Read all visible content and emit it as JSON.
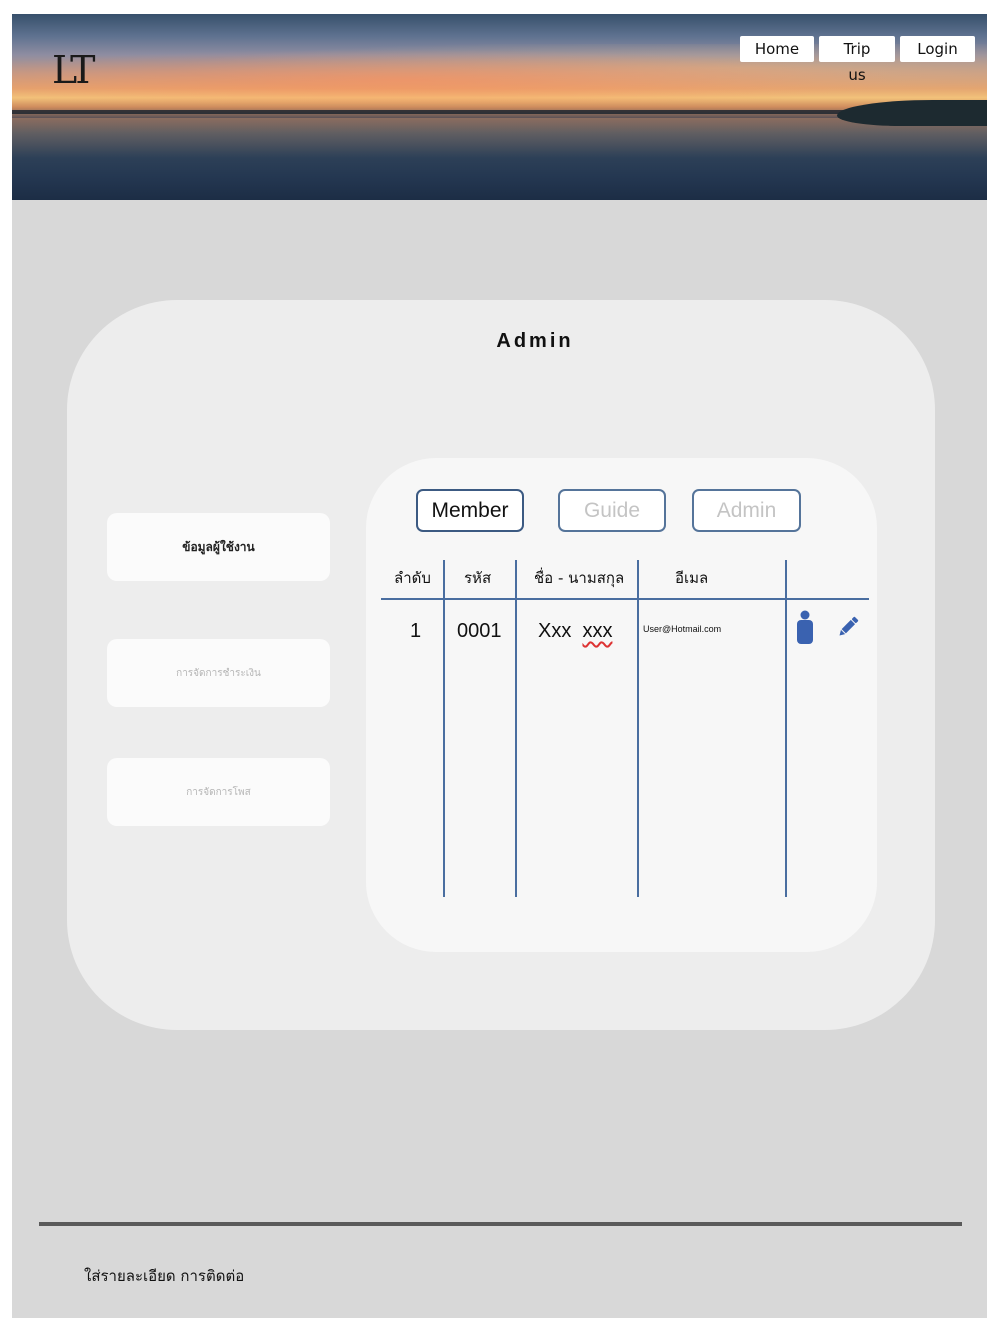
{
  "header": {
    "logo_text": "LT",
    "nav": {
      "home": "Home",
      "trip_us": "Trip us",
      "login": "Login"
    }
  },
  "admin": {
    "title": "Admin",
    "sidebar": {
      "user_info": "ข้อมูลผู้ใช้งาน",
      "payment": "การจัดการชำระเงิน",
      "post": "การจัดการโพส"
    },
    "tabs": {
      "member": "Member",
      "guide": "Guide",
      "admin": "Admin"
    },
    "table": {
      "columns": [
        "ลำดับ",
        "รหัส",
        "ชื่อ - นามสกุล",
        "อีเมล"
      ],
      "rows": [
        {
          "index": "1",
          "code": "0001",
          "name_first": "Xxx",
          "name_last": "xxx",
          "email": "User@Hotmail.com"
        }
      ]
    }
  },
  "footer": {
    "text": "ใส่รายละเอียด การติดต่อ"
  },
  "colors": {
    "frame_bg": "#d8d8d8",
    "card_bg": "#ededed",
    "tab_border": "#3c5a82",
    "table_lines": "#4a6ea0",
    "icon_blue": "#3a62b0"
  }
}
